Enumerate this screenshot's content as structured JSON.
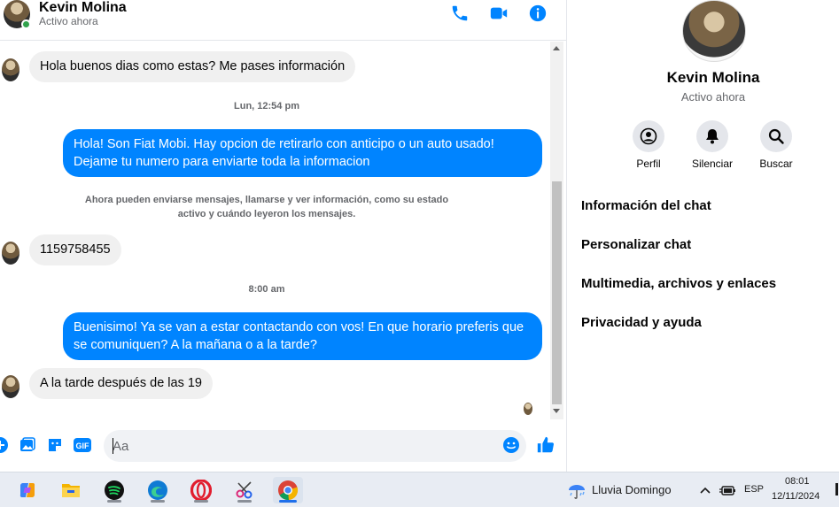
{
  "header": {
    "name": "Kevin Molina",
    "status": "Activo ahora"
  },
  "messages": {
    "msg1": "Hola buenos dias como estas? Me pases información",
    "time1": "Lun, 12:54 pm",
    "msg2": "Hola! Son Fiat Mobi. Hay opcion de retirarlo con anticipo o un auto usado! Dejame tu numero para enviarte toda la informacion",
    "system_note": "Ahora pueden enviarse mensajes, llamarse y ver información, como su estado activo y cuándo leyeron los mensajes.",
    "msg3": "1159758455",
    "time2": "8:00 am",
    "msg4": "Buenisimo! Ya se van a estar contactando con vos! En que horario preferis que se comuniquen? A la mañana o a la tarde?",
    "msg5": "A la tarde después de las 19"
  },
  "composer": {
    "placeholder": "Aa"
  },
  "info_panel": {
    "name": "Kevin Molina",
    "status": "Activo ahora",
    "actions": {
      "profile": "Perfil",
      "mute": "Silenciar",
      "search": "Buscar"
    },
    "sections": {
      "chat_info": "Información del chat",
      "customize": "Personalizar chat",
      "media": "Multimedia, archivos y enlaces",
      "privacy": "Privacidad y ayuda"
    }
  },
  "taskbar": {
    "weather": "Lluvia Domingo",
    "language": "ESP",
    "time": "08:01",
    "date": "12/11/2024"
  },
  "colors": {
    "accent": "#0084ff",
    "incoming_bubble": "#f0f0f0",
    "online": "#31a24c"
  }
}
